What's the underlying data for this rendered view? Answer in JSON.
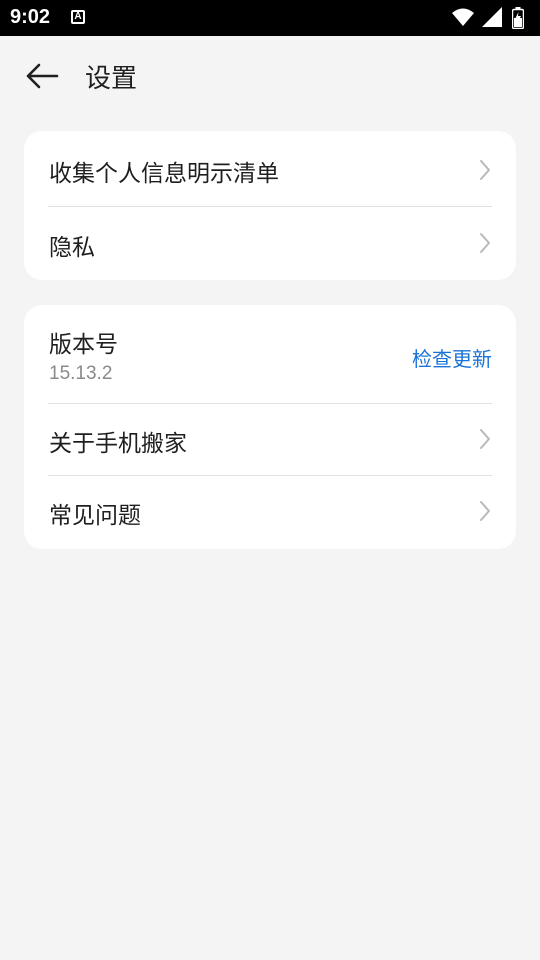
{
  "status_bar": {
    "time": "9:02",
    "notification_letter": "A",
    "icons": [
      "wifi-icon",
      "cellular-signal-icon",
      "battery-icon"
    ]
  },
  "app_bar": {
    "title": "设置",
    "back_icon": "arrow-left-icon"
  },
  "card1": {
    "items": [
      {
        "label": "收集个人信息明示清单"
      },
      {
        "label": "隐私"
      }
    ]
  },
  "card2": {
    "version": {
      "label": "版本号",
      "value": "15.13.2",
      "action": "检查更新"
    },
    "items": [
      {
        "label": "关于手机搬家"
      },
      {
        "label": "常见问题"
      }
    ]
  },
  "colors": {
    "background": "#f4f4f4",
    "card": "#ffffff",
    "accent": "#1a73d9",
    "text_primary": "#1f1f1f",
    "text_secondary": "#8a8a8a"
  }
}
